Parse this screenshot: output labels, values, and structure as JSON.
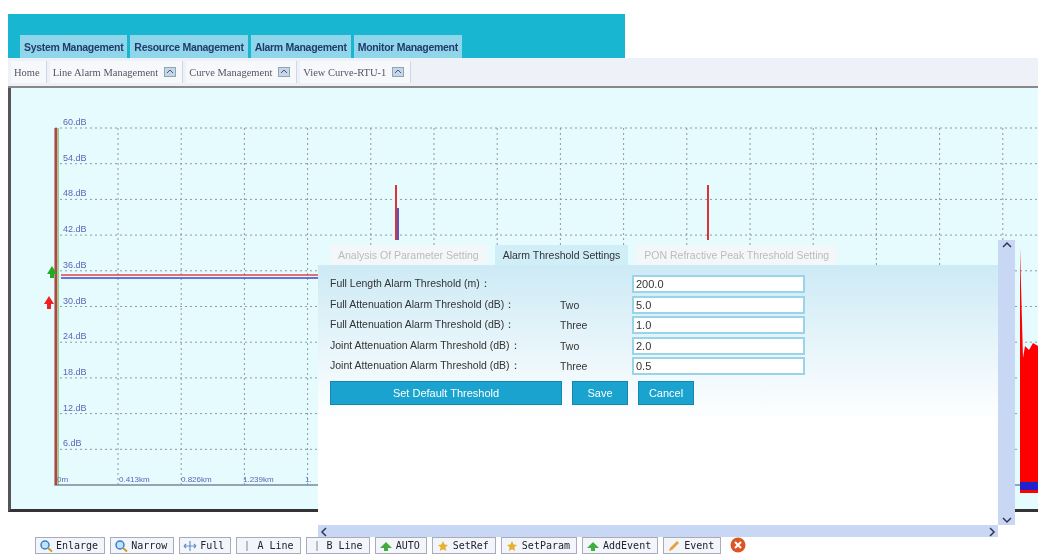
{
  "menu": [
    {
      "label": "System Management"
    },
    {
      "label": "Resource Management"
    },
    {
      "label": "Alarm Management"
    },
    {
      "label": "Monitor Management"
    }
  ],
  "page_tabs": [
    {
      "label": "Home",
      "closable": false
    },
    {
      "label": "Line Alarm Management",
      "closable": true
    },
    {
      "label": "Curve Management",
      "closable": true
    },
    {
      "label": "View Curve-RTU-1",
      "closable": true
    }
  ],
  "chart": {
    "y_labels": [
      "60.dB",
      "54.dB",
      "48.dB",
      "42.dB",
      "36.dB",
      "30.dB",
      "24.dB",
      "18.dB",
      "12.dB",
      "6.dB"
    ],
    "x_labels": [
      "0m",
      "0.413km",
      "0.826km",
      "1.239km",
      "1."
    ]
  },
  "dialog": {
    "tabs": [
      {
        "label": "Analysis Of Parameter Setting",
        "selected": false
      },
      {
        "label": "Alarm Threshold Settings",
        "selected": true
      },
      {
        "label": "PON Refractive Peak Threshold Setting",
        "selected": false
      }
    ],
    "fields": [
      {
        "label": "Full Length Alarm Threshold (m)：",
        "value": "200.0"
      },
      {
        "label": "Full Attenuation Alarm Threshold (dB)：",
        "level_name": "Two",
        "value": "5.0"
      },
      {
        "label": "Full Attenuation Alarm Threshold (dB)：",
        "level_name": "Three",
        "value": "1.0"
      },
      {
        "label": "Joint Attenuation Alarm Threshold (dB)：",
        "level_name": "Two",
        "value": "2.0"
      },
      {
        "label": "Joint Attenuation Alarm Threshold (dB)：",
        "level_name": "Three",
        "value": "0.5"
      }
    ],
    "buttons": [
      {
        "label": "Set Default Threshold",
        "kind": "wide"
      },
      {
        "label": "Save",
        "kind": "small"
      },
      {
        "label": "Cancel",
        "kind": "small"
      }
    ]
  },
  "toolbar": [
    {
      "label": "Enlarge",
      "kind": "zoom"
    },
    {
      "label": "Narrow",
      "kind": "zoom"
    },
    {
      "label": "Full",
      "kind": "fit"
    },
    {
      "label": "A Line",
      "kind": "cursor"
    },
    {
      "label": "B Line",
      "kind": "cursor"
    },
    {
      "label": "AUTO",
      "kind": "run"
    },
    {
      "label": "SetRef",
      "kind": "set"
    },
    {
      "label": "SetParam",
      "kind": "set"
    },
    {
      "label": "AddEvent",
      "kind": "run"
    },
    {
      "label": "Event",
      "kind": "edit"
    }
  ]
}
